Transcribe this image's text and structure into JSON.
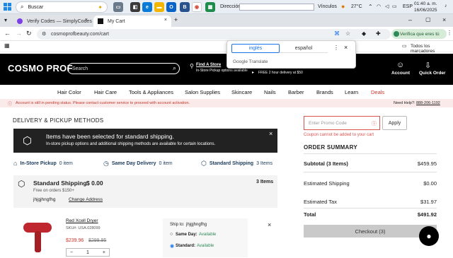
{
  "taskbar": {
    "search_label": "Buscar",
    "address_label": "Dirección",
    "links_label": "Vínculos",
    "weather": "27°C",
    "lang": "ESP",
    "time": "01:40 a. m.",
    "date": "16/06/2025"
  },
  "browser": {
    "tabs": [
      {
        "label": "Verify Codes — SimplyCodes"
      },
      {
        "label": "My Cart"
      }
    ],
    "url": "cosmoprofbeauty.com/cart",
    "verify_chip": "Verifica que eres tú",
    "bookmarks_all": "Todos los marcadores"
  },
  "translate": {
    "lang_active": "inglés",
    "lang_other": "español",
    "brand": "Google Translate"
  },
  "site": {
    "logo": "COSMO PROF",
    "search_placeholder": "Search",
    "store_link": "Find A Store",
    "store_sub": "In-Store Pickup options available",
    "delivery_sub": "FREE 2 hour delivery at $50",
    "account_label": "Account",
    "quick_order_label": "Quick Order",
    "nav": [
      "Hair Color",
      "Hair Care",
      "Tools & Appliances",
      "Salon Supplies",
      "Skincare",
      "Nails",
      "Barber",
      "Brands",
      "Learn",
      "Deals"
    ],
    "alert": "Account is still in pending status. Please contact customer service to proceed with account activation.",
    "help_label": "Need Help?:",
    "help_phone": "888-206-1192"
  },
  "cart": {
    "section_title": "DELIVERY & PICKUP METHODS",
    "banner_title": "Items have been selected for standard shipping.",
    "banner_text": "In-store pickup options and additional shipping methods are available for certain locations.",
    "options": [
      {
        "label": "In-Store Pickup",
        "count": "0 item"
      },
      {
        "label": "Same Day Delivery",
        "count": "0 item"
      },
      {
        "label": "Standard Shipping",
        "count": "3 Items"
      }
    ],
    "standard": {
      "title": "Standard Shipping",
      "price": "$ 0.00",
      "items": "3 Items",
      "free_note": "Free on orders $150+",
      "address_name": "jhjgjhngfhg",
      "change_link": "Change Address"
    },
    "product": {
      "name": "Red Xcell Dryer",
      "sku": "SKU#: USA.028099",
      "price": "$239.96",
      "old_price": "$299.95",
      "qty": "1"
    },
    "ship_to": {
      "label": "Ship to:",
      "name": "jhjgjhngfhg",
      "same_day": "Same Day:",
      "same_day_status": "Available",
      "standard": "Standard:",
      "standard_status": "Available"
    }
  },
  "summary": {
    "promo_placeholder": "Enter Promo Code",
    "apply_label": "Apply",
    "promo_error": "Coupon cannot be added to your cart",
    "title": "ORDER SUMMARY",
    "subtotal_label": "Subtotal (3 Items)",
    "subtotal": "$459.95",
    "shipping_label": "Estimated Shipping",
    "shipping": "$0.00",
    "tax_label": "Estimated Tax",
    "tax": "$31.97",
    "total_label": "Total",
    "total": "$491.92",
    "checkout_label": "Checkout (3)"
  },
  "colors": {
    "accent_red": "#d9534f",
    "deals_red": "#d0342c",
    "link_blue": "#1a3a5c"
  }
}
